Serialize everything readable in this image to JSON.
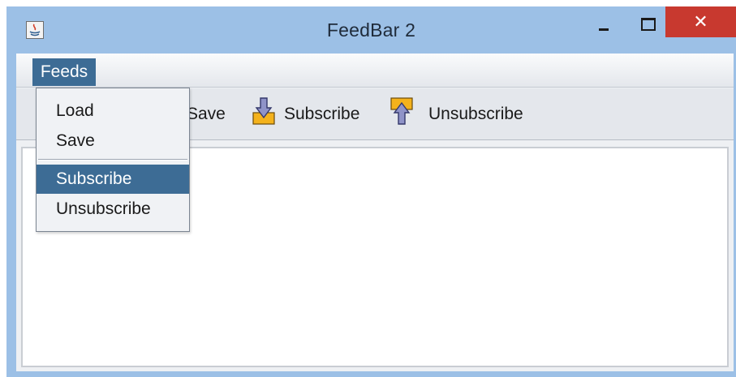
{
  "window": {
    "title": "FeedBar 2",
    "close_glyph": "✕"
  },
  "menubar": {
    "feeds_label": "Feeds"
  },
  "menu": {
    "items": [
      {
        "label": "Load",
        "selected": false
      },
      {
        "label": "Save",
        "selected": false
      },
      {
        "label": "Subscribe",
        "selected": true
      },
      {
        "label": "Unsubscribe",
        "selected": false
      }
    ]
  },
  "toolbar": {
    "save_label": "Save",
    "subscribe_label": "Subscribe",
    "unsubscribe_label": "Unsubscribe",
    "subscribe_icon": "subscribe-down-arrow-icon",
    "unsubscribe_icon": "unsubscribe-up-arrow-icon"
  },
  "colors": {
    "titlebar": "#9cc0e6",
    "close_button": "#c8392f",
    "menu_highlight": "#3d6c95"
  }
}
